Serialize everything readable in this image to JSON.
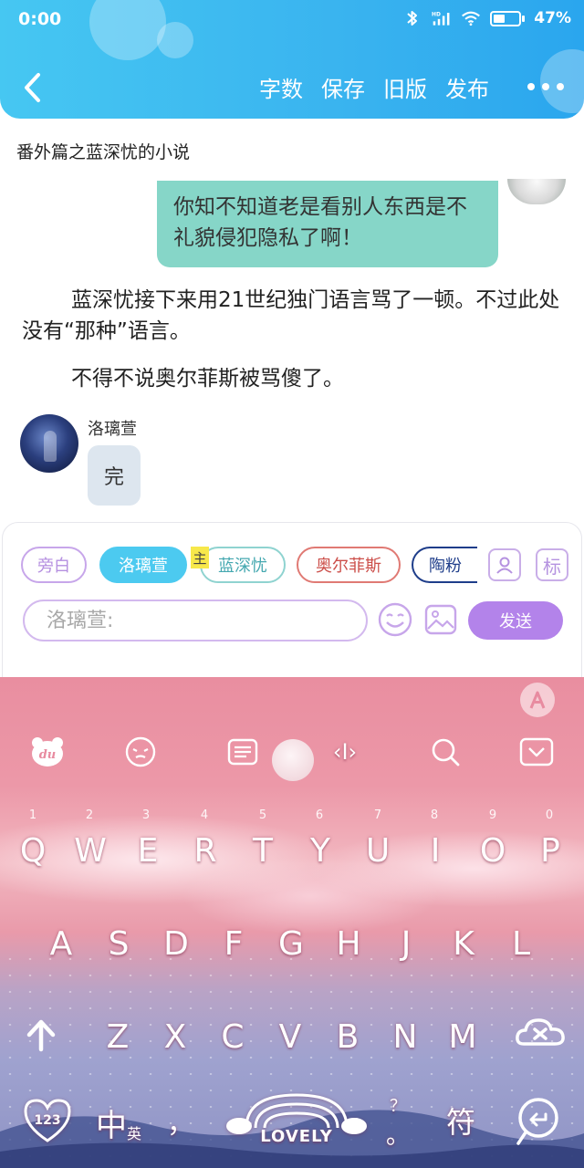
{
  "status_bar": {
    "time": "0:00",
    "hd_label": "HD",
    "battery_percent": "47%",
    "battery_level": 0.47
  },
  "nav": {
    "back_icon": "chevron-left-icon",
    "actions": [
      "字数",
      "保存",
      "旧版",
      "发布"
    ],
    "more_icon": "more-dots-icon"
  },
  "chapter_title": "番外篇之蓝深忧的小说",
  "chat": {
    "right_bubble_text": "你知不知道老是看别人东西是不礼貌侵犯隐私了啊！",
    "narration_1": "蓝深忧接下来用21世纪独门语言骂了一顿。不过此处没有“那种”语言。",
    "narration_2": "不得不说奥尔菲斯被骂傻了。",
    "left_speaker": "洛璃萱",
    "left_bubble_text": "完"
  },
  "composer": {
    "roles": [
      "旁白",
      "洛璃萱",
      "蓝深忧",
      "奥尔菲斯",
      "陶粉"
    ],
    "selected_role": "洛璃萱",
    "main_badge": "主",
    "tag_button": "标",
    "input_placeholder": "洛璃萱:",
    "send_label": "发送"
  },
  "keyboard": {
    "toolbar_icons": [
      "du-bear-icon",
      "emoji-face-icon",
      "clipboard-icon",
      "text-cursor-icon",
      "search-icon",
      "collapse-keyboard-icon"
    ],
    "cursor_label": "‹I›",
    "digits": [
      "1",
      "2",
      "3",
      "4",
      "5",
      "6",
      "7",
      "8",
      "9",
      "0"
    ],
    "row1": [
      "Q",
      "W",
      "E",
      "R",
      "T",
      "Y",
      "U",
      "I",
      "O",
      "P"
    ],
    "row2": [
      "A",
      "S",
      "D",
      "F",
      "G",
      "H",
      "J",
      "K",
      "L"
    ],
    "row3": [
      "Z",
      "X",
      "C",
      "V",
      "B",
      "N",
      "M"
    ],
    "numbers_key": "123",
    "lang_key": "中",
    "lang_alt": "英",
    "comma_key": "，",
    "space_label": "LOVELY",
    "period_key": "。",
    "question_key": "？",
    "symbol_key": "符",
    "colors": {
      "header": "#39b3ef",
      "send": "#b383ea",
      "chat_right": "#86d6c8",
      "chat_left": "#dde6ef"
    }
  }
}
